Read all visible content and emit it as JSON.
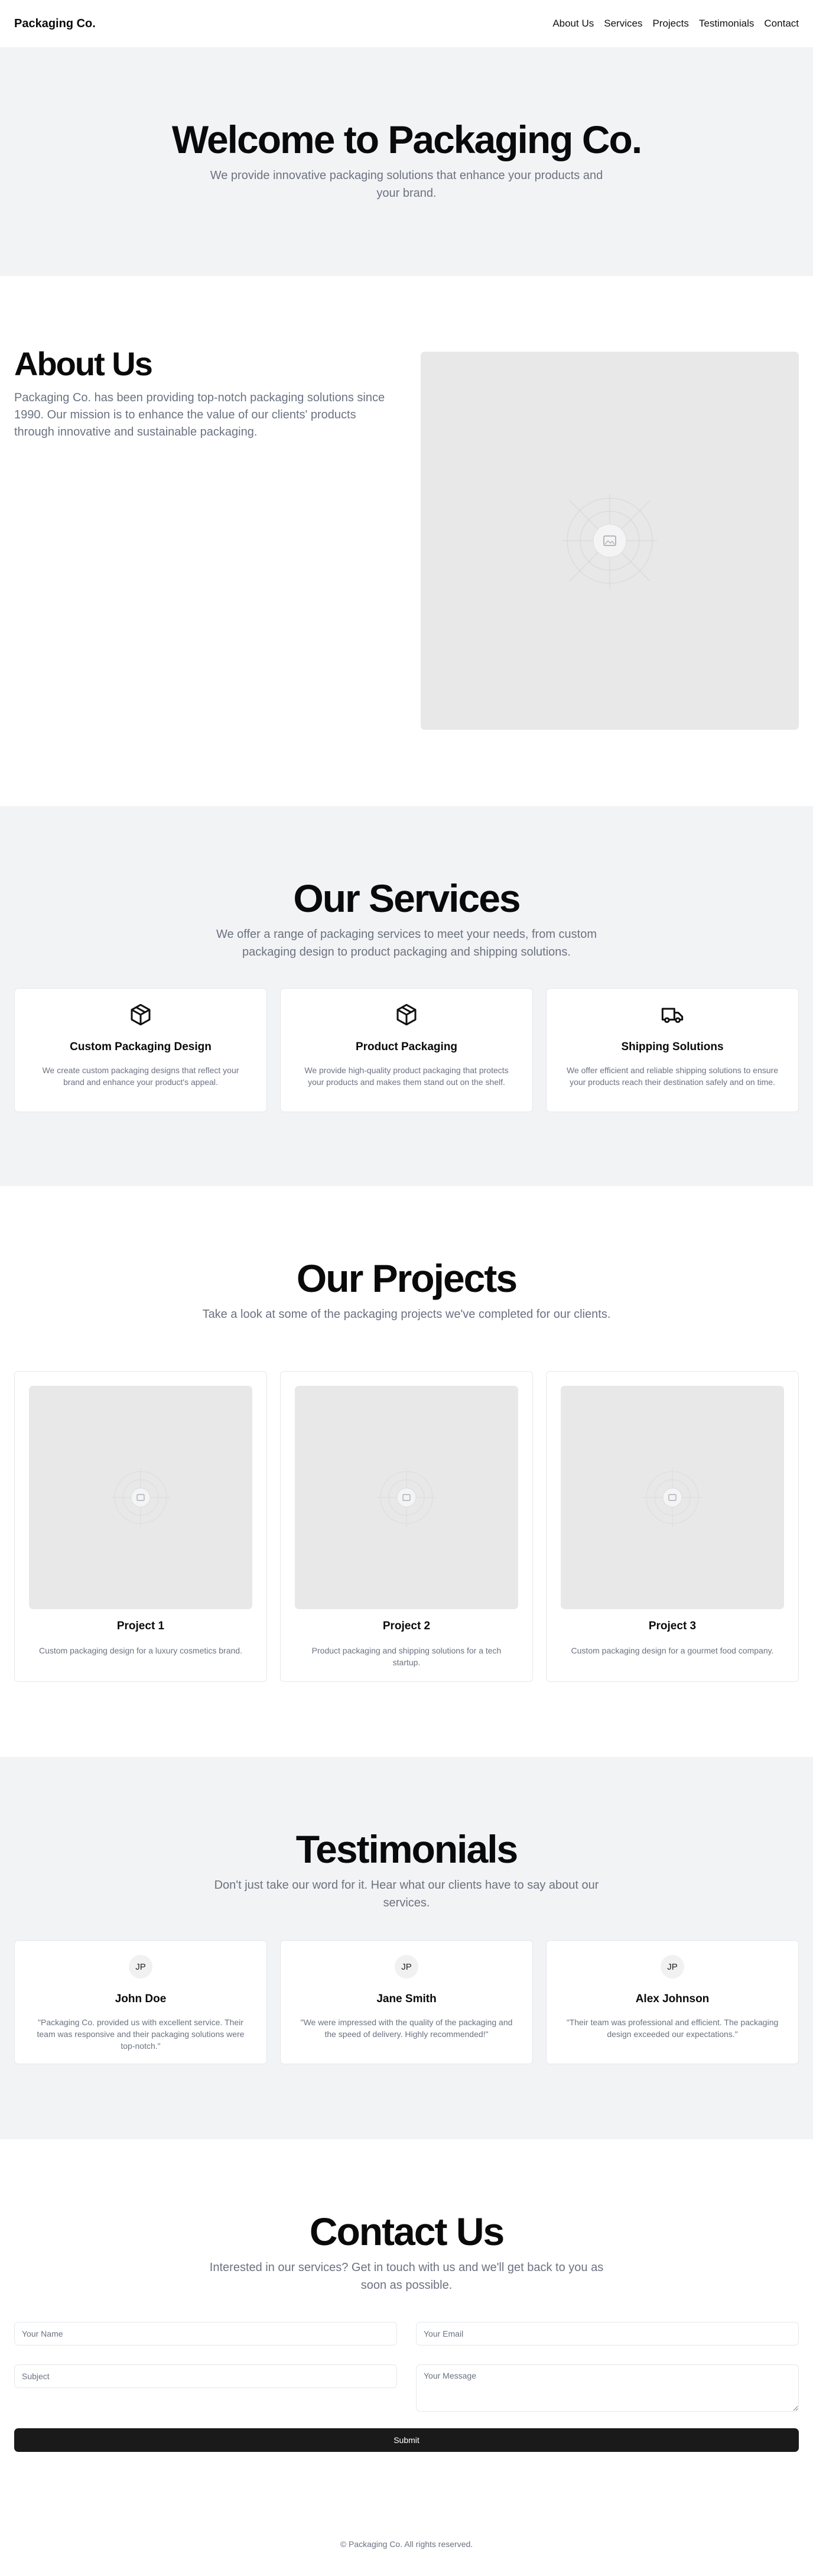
{
  "header": {
    "brand": "Packaging Co.",
    "nav": [
      "About Us",
      "Services",
      "Projects",
      "Testimonials",
      "Contact"
    ]
  },
  "hero": {
    "title": "Welcome to Packaging Co.",
    "subtitle": "We provide innovative packaging solutions that enhance your products and your brand."
  },
  "about": {
    "title": "About Us",
    "text": "Packaging Co. has been providing top-notch packaging solutions since 1990. Our mission is to enhance the value of our clients' products through innovative and sustainable packaging.",
    "image_icon": "image-placeholder-icon"
  },
  "services": {
    "title": "Our Services",
    "subtitle": "We offer a range of packaging services to meet your needs, from custom packaging design to product packaging and shipping solutions.",
    "items": [
      {
        "icon": "box-icon",
        "title": "Custom Packaging Design",
        "desc": "We create custom packaging designs that reflect your brand and enhance your product's appeal."
      },
      {
        "icon": "box-icon",
        "title": "Product Packaging",
        "desc": "We provide high-quality product packaging that protects your products and makes them stand out on the shelf."
      },
      {
        "icon": "truck-icon",
        "title": "Shipping Solutions",
        "desc": "We offer efficient and reliable shipping solutions to ensure your products reach their destination safely and on time."
      }
    ]
  },
  "projects": {
    "title": "Our Projects",
    "subtitle": "Take a look at some of the packaging projects we've completed for our clients.",
    "items": [
      {
        "title": "Project 1",
        "desc": "Custom packaging design for a luxury cosmetics brand."
      },
      {
        "title": "Project 2",
        "desc": "Product packaging and shipping solutions for a tech startup."
      },
      {
        "title": "Project 3",
        "desc": "Custom packaging design for a gourmet food company."
      }
    ]
  },
  "testimonials": {
    "title": "Testimonials",
    "subtitle": "Don't just take our word for it. Hear what our clients have to say about our services.",
    "items": [
      {
        "initials": "JP",
        "name": "John Doe",
        "quote": "\"Packaging Co. provided us with excellent service. Their team was responsive and their packaging solutions were top-notch.\""
      },
      {
        "initials": "JP",
        "name": "Jane Smith",
        "quote": "\"We were impressed with the quality of the packaging and the speed of delivery. Highly recommended!\""
      },
      {
        "initials": "JP",
        "name": "Alex Johnson",
        "quote": "\"Their team was professional and efficient. The packaging design exceeded our expectations.\""
      }
    ]
  },
  "contact": {
    "title": "Contact Us",
    "subtitle": "Interested in our services? Get in touch with us and we'll get back to you as soon as possible.",
    "name_placeholder": "Your Name",
    "email_placeholder": "Your Email",
    "subject_placeholder": "Subject",
    "message_placeholder": "Your Message",
    "submit_label": "Submit"
  },
  "footer": {
    "text": "© Packaging Co. All rights reserved."
  },
  "colors": {
    "section_gray": "#f2f3f5",
    "muted_text": "#6b7280",
    "button_dark": "#1a1a1a",
    "placeholder_bg": "#e8e8e8"
  }
}
